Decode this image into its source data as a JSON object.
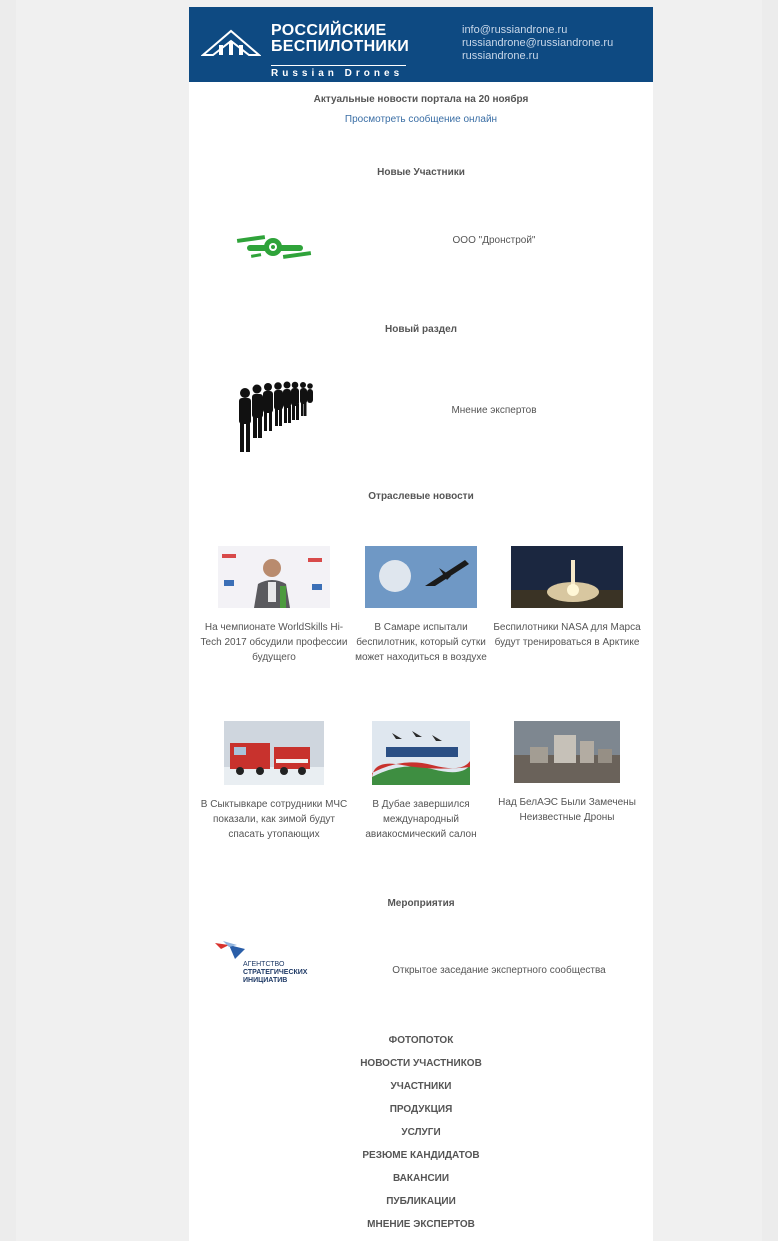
{
  "header": {
    "logo_ru_line1": "РОССИЙСКИЕ",
    "logo_ru_line2": "БЕСПИЛОТНИКИ",
    "logo_en": "Russian Drones",
    "contacts": [
      "info@russiandrone.ru",
      "russiandrone@russiandrone.ru",
      "russiandrone.ru"
    ]
  },
  "intro": {
    "title": "Актуальные новости портала на 20 ноября",
    "view_online": "Просмотреть сообщение онлайн"
  },
  "sections": {
    "new_members": {
      "heading": "Новые Участники",
      "item": "ООО \"Дронстрой\""
    },
    "new_section": {
      "heading": "Новый раздел",
      "item": "Мнение экспертов"
    },
    "industry_news": {
      "heading": "Отраслевые новости",
      "items": [
        {
          "caption": "На чемпионате WorldSkills Hi-Tech 2017 обсудили профессии будущего",
          "thumb": "speaker-photo"
        },
        {
          "caption": "В Самаре испытали беспилотник, который сутки может находиться в воздухе",
          "thumb": "drone-sky-photo"
        },
        {
          "caption": "Беспилотники NASA для Марса будут тренироваться в Арктике",
          "thumb": "rocket-launch-photo"
        },
        {
          "caption": "В Сыктывкаре сотрудники МЧС показали, как зимой будут спасать утопающих",
          "thumb": "fire-trucks-photo"
        },
        {
          "caption": "В Дубае завершился международный авиакосмический салон",
          "thumb": "airshow-banner-photo"
        },
        {
          "caption": "Над БелАЭС Были Замечены Неизвестные Дроны",
          "thumb": "power-plant-photo"
        }
      ]
    },
    "events": {
      "heading": "Мероприятия",
      "logo_lines": [
        "АГЕНТСТВО",
        "СТРАТЕГИЧЕСКИХ",
        "ИНИЦИАТИВ"
      ],
      "item": "Открытое заседание экспертного сообщества"
    }
  },
  "footer_links": [
    "ФОТОПОТОК",
    "НОВОСТИ УЧАСТНИКОВ",
    "УЧАСТНИКИ",
    "ПРОДУКЦИЯ",
    "УСЛУГИ",
    "РЕЗЮМЕ КАНДИДАТОВ",
    "ВАКАНСИИ",
    "ПУБЛИКАЦИИ",
    "МНЕНИЕ ЭКСПЕРТОВ"
  ],
  "colors": {
    "header_bg": "#0e4a82",
    "link": "#3a6ea5",
    "drone_green": "#2fa33a"
  }
}
